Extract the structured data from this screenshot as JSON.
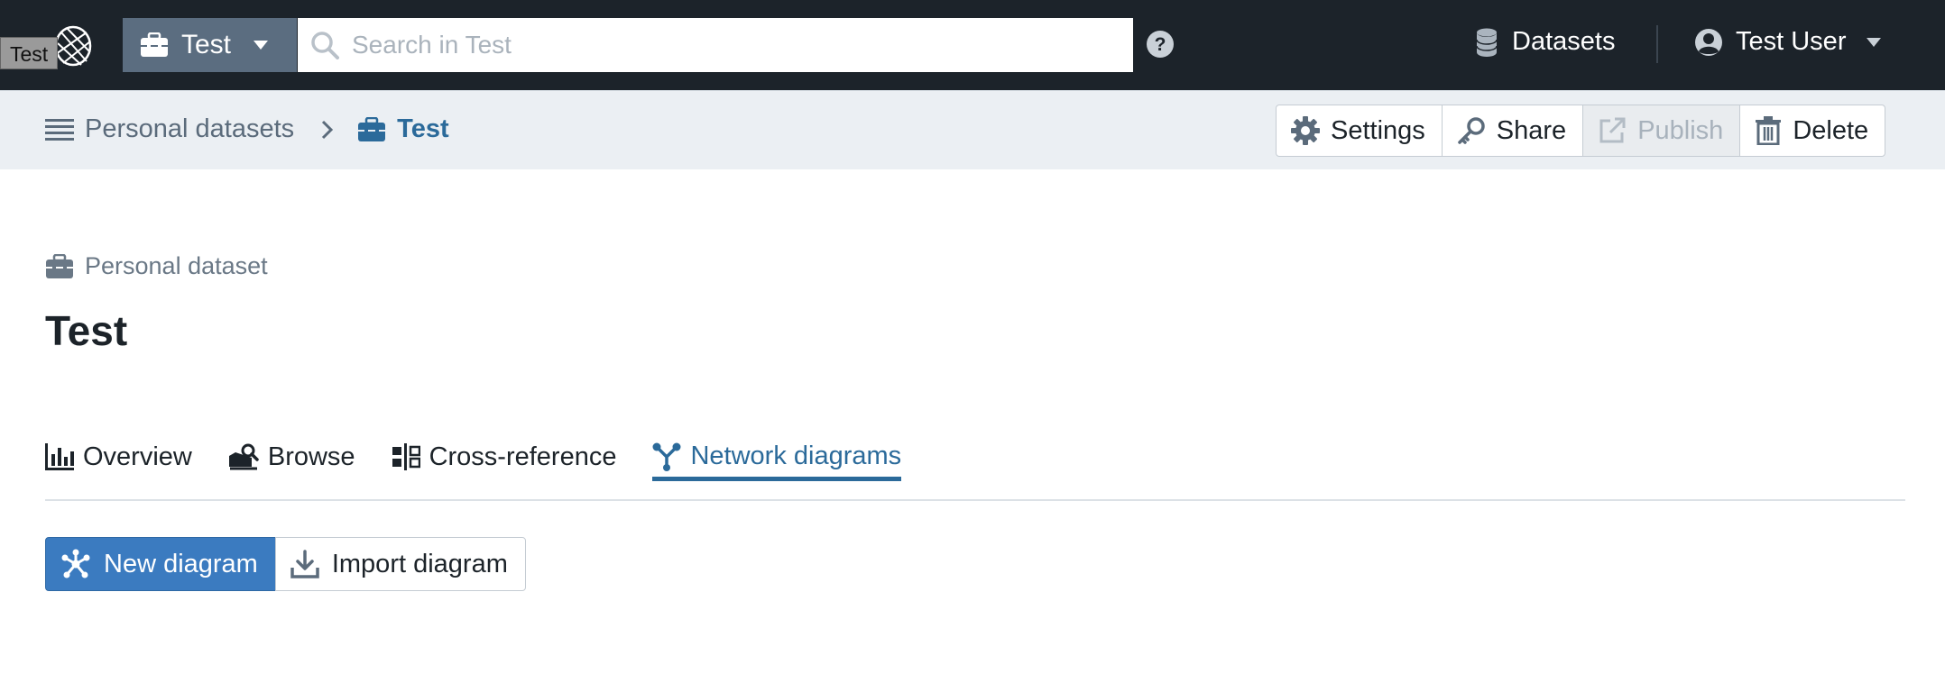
{
  "topbar": {
    "logo_tooltip": "Test",
    "dataset_switcher_label": "Test",
    "search_placeholder": "Search in Test",
    "datasets_label": "Datasets",
    "user_label": "Test User"
  },
  "breadcrumb": {
    "root_label": "Personal datasets",
    "current_label": "Test"
  },
  "actions": {
    "settings_label": "Settings",
    "share_label": "Share",
    "publish_label": "Publish",
    "delete_label": "Delete"
  },
  "heading": {
    "kicker": "Personal dataset",
    "title": "Test"
  },
  "tabs": [
    {
      "label": "Overview",
      "icon": "bar-chart-icon",
      "active": false
    },
    {
      "label": "Browse",
      "icon": "browse-icon",
      "active": false
    },
    {
      "label": "Cross-reference",
      "icon": "cross-reference-icon",
      "active": false
    },
    {
      "label": "Network diagrams",
      "icon": "network-icon",
      "active": true
    }
  ],
  "buttons": {
    "new_diagram_label": "New diagram",
    "import_diagram_label": "Import diagram"
  },
  "colors": {
    "topbar_bg": "#1c232a",
    "accent": "#2b6a9a",
    "primary_button": "#3b7bc0"
  }
}
